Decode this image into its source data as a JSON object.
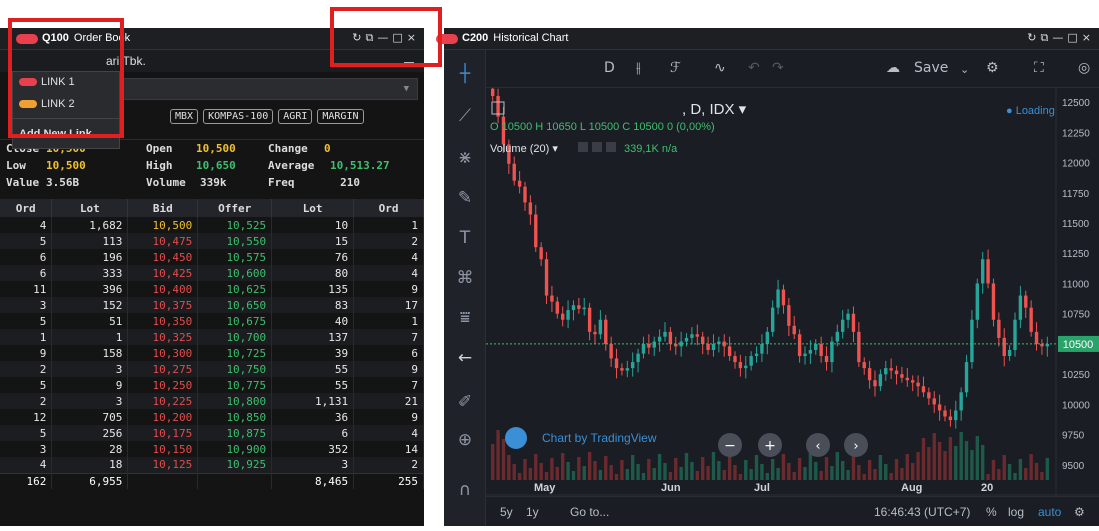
{
  "orderbook": {
    "panel_code": "Q100",
    "panel_title": "Order Book",
    "window_controls": [
      "↻",
      "⧉",
      "—",
      "□",
      "×"
    ],
    "stock_name_partial": "ari Tbk.",
    "price_prev_partial": "0",
    "tags": [
      "MBX",
      "KOMPAS-100",
      "AGRI",
      "MARGIN"
    ],
    "stats": {
      "close_label": "Close",
      "close_value": "10,500",
      "open_label": "Open",
      "open_value": "10,500",
      "change_label": "Change",
      "change_value": "0",
      "low_label": "Low",
      "low_value": "10,500",
      "high_label": "High",
      "high_value": "10,650",
      "average_label": "Average",
      "average_value": "10,513.27",
      "value_label": "Value",
      "value_value": "3.56B",
      "volume_label": "Volume",
      "volume_value": "339k",
      "freq_label": "Freq",
      "freq_value": "210"
    },
    "headers": [
      "Ord",
      "Lot",
      "Bid",
      "Offer",
      "Lot",
      "Ord"
    ],
    "rows": [
      [
        "4",
        "1,682",
        "10,500",
        "10,525",
        "10",
        "1"
      ],
      [
        "5",
        "113",
        "10,475",
        "10,550",
        "15",
        "2"
      ],
      [
        "6",
        "196",
        "10,450",
        "10,575",
        "76",
        "4"
      ],
      [
        "6",
        "333",
        "10,425",
        "10,600",
        "80",
        "4"
      ],
      [
        "11",
        "396",
        "10,400",
        "10,625",
        "135",
        "9"
      ],
      [
        "3",
        "152",
        "10,375",
        "10,650",
        "83",
        "17"
      ],
      [
        "5",
        "51",
        "10,350",
        "10,675",
        "40",
        "1"
      ],
      [
        "1",
        "1",
        "10,325",
        "10,700",
        "137",
        "7"
      ],
      [
        "9",
        "158",
        "10,300",
        "10,725",
        "39",
        "6"
      ],
      [
        "2",
        "3",
        "10,275",
        "10,750",
        "55",
        "9"
      ],
      [
        "5",
        "9",
        "10,250",
        "10,775",
        "55",
        "7"
      ],
      [
        "2",
        "3",
        "10,225",
        "10,800",
        "1,131",
        "21"
      ],
      [
        "12",
        "705",
        "10,200",
        "10,850",
        "36",
        "9"
      ],
      [
        "5",
        "256",
        "10,175",
        "10,875",
        "6",
        "4"
      ],
      [
        "3",
        "28",
        "10,150",
        "10,900",
        "352",
        "14"
      ],
      [
        "4",
        "18",
        "10,125",
        "10,925",
        "3",
        "2"
      ]
    ],
    "totals": [
      "162",
      "6,955",
      "",
      "",
      "8,465",
      "255"
    ],
    "link_menu": {
      "items": [
        {
          "label": "LINK 1",
          "color": "#e8404c"
        },
        {
          "label": "LINK 2",
          "color": "#f0a030"
        }
      ],
      "add_label": "Add New Link"
    }
  },
  "chart": {
    "panel_code": "C200",
    "panel_title": "Historical Chart",
    "window_controls": [
      "↻",
      "⧉",
      "—",
      "□",
      "×"
    ],
    "interval": "D",
    "save_label": "Save",
    "legend_symbol": ", D, IDX ▾",
    "loading": "● Loading",
    "ohlc": "O 10500  H 10650  L 10500  C 10500  0 (0,00%)",
    "volume_label": "Volume (20) ▾",
    "volume_values": "339,1K  n/a",
    "watermark": "Chart by TradingView",
    "current_price": "10500",
    "bottom": {
      "range_5y": "5y",
      "range_1y": "1y",
      "goto": "Go to...",
      "time": "16:46:43 (UTC+7)",
      "pct": "%",
      "log": "log",
      "auto": "auto"
    },
    "chart_data": {
      "type": "candlestick",
      "x_ticks": [
        "May",
        "Jun",
        "Jul",
        "Aug",
        "20"
      ],
      "y_ticks": [
        12500,
        12250,
        12000,
        11750,
        11500,
        11250,
        11000,
        10750,
        10500,
        10250,
        10000,
        9750,
        9500
      ],
      "ylim": [
        9375,
        12550
      ],
      "current_price": 10500,
      "close_series": [
        12550,
        12380,
        12150,
        11990,
        11850,
        11800,
        11670,
        11570,
        11300,
        11200,
        10900,
        10850,
        10750,
        10700,
        10780,
        10820,
        10790,
        10800,
        10600,
        10580,
        10700,
        10500,
        10380,
        10300,
        10280,
        10300,
        10350,
        10420,
        10500,
        10470,
        10520,
        10560,
        10600,
        10500,
        10480,
        10520,
        10550,
        10580,
        10560,
        10500,
        10450,
        10500,
        10520,
        10480,
        10400,
        10350,
        10300,
        10320,
        10400,
        10420,
        10500,
        10600,
        10800,
        10950,
        10820,
        10650,
        10580,
        10400,
        10420,
        10450,
        10500,
        10400,
        10350,
        10520,
        10600,
        10700,
        10750,
        10600,
        10350,
        10300,
        10200,
        10150,
        10250,
        10300,
        10280,
        10250,
        10220,
        10200,
        10180,
        10150,
        10100,
        10050,
        10000,
        9950,
        9900,
        9870,
        9950,
        10100,
        10350,
        10700,
        11000,
        11200,
        11000,
        10700,
        10550,
        10400,
        10450,
        10700,
        10900,
        10800,
        10600,
        10500,
        10480,
        10500
      ]
    }
  }
}
